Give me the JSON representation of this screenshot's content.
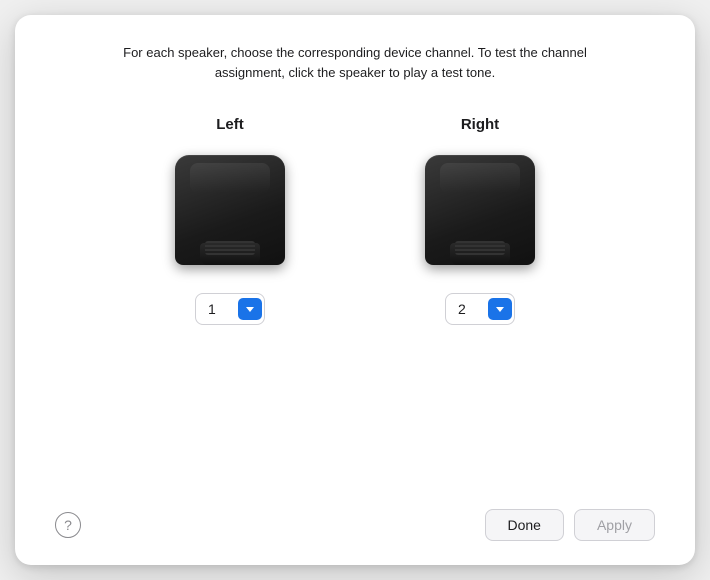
{
  "dialog": {
    "description": "For each speaker, choose the corresponding device channel. To test the channel assignment, click the speaker to play a test tone."
  },
  "speakers": [
    {
      "id": "left",
      "label": "Left",
      "channel_value": "1"
    },
    {
      "id": "right",
      "label": "Right",
      "channel_value": "2"
    }
  ],
  "buttons": {
    "help_label": "?",
    "done_label": "Done",
    "apply_label": "Apply"
  },
  "colors": {
    "dropdown_bg": "#1a73e8",
    "disabled_text": "#a0a0a5"
  }
}
